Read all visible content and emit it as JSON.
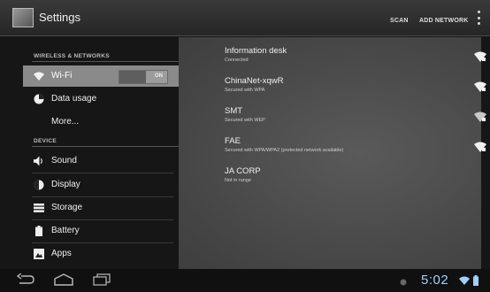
{
  "action_bar": {
    "title": "Settings",
    "scan_label": "SCAN",
    "add_network_label": "ADD NETWORK"
  },
  "sidebar": {
    "section_wireless": "WIRELESS & NETWORKS",
    "section_device": "DEVICE",
    "items": [
      {
        "label": "Wi-Fi",
        "icon": "wifi-icon",
        "toggle": "ON"
      },
      {
        "label": "Data usage",
        "icon": "data-usage-icon"
      },
      {
        "label": "More...",
        "icon": ""
      },
      {
        "label": "Sound",
        "icon": "sound-icon"
      },
      {
        "label": "Display",
        "icon": "display-icon"
      },
      {
        "label": "Storage",
        "icon": "storage-icon"
      },
      {
        "label": "Battery",
        "icon": "battery-icon"
      },
      {
        "label": "Apps",
        "icon": "apps-icon"
      }
    ]
  },
  "networks": [
    {
      "name": "Information desk",
      "status": "Connected"
    },
    {
      "name": "ChinaNet-xqwR",
      "status": "Secured with WPA"
    },
    {
      "name": "SMT",
      "status": "Secured with WEP"
    },
    {
      "name": "FAE",
      "status": "Secured with WPA/WPA2 (protected network available)"
    },
    {
      "name": "JA CORP",
      "status": "Not in range"
    }
  ],
  "status_bar": {
    "time": "5:02"
  },
  "colors": {
    "selected_item": "#8a8a8a",
    "clock": "#9fd0ff"
  }
}
